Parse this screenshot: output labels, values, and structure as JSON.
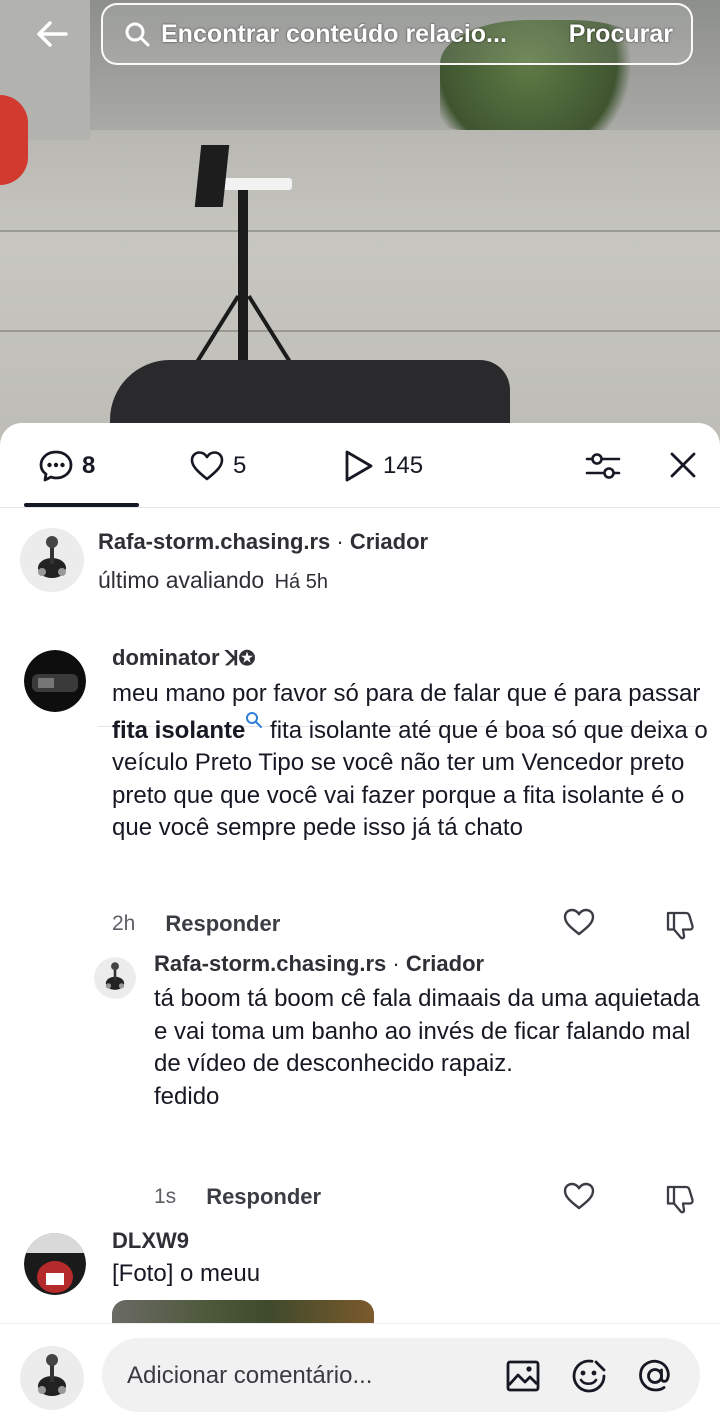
{
  "search": {
    "query": "Encontrar conteúdo relacio...",
    "button_label": "Procurar"
  },
  "stats": {
    "comments": "8",
    "likes": "5",
    "plays": "145"
  },
  "pinned": {
    "author": "Rafa-storm.chasing.rs",
    "separator": " · ",
    "badge": "Criador",
    "note": "último avaliando",
    "time": "Há 5h"
  },
  "comments": [
    {
      "author": "dominator",
      "author_suffix": "ꓘ✪",
      "text_before": "meu mano por favor só para de falar que é para passar ",
      "keyword": "fita isolante",
      "text_after": " fita isolante até que é boa só que deixa o veículo Preto Tipo se você não ter um Vencedor preto preto que que você vai fazer porque a fita isolante é o que você sempre pede isso já tá chato",
      "time": "2h",
      "reply_label": "Responder"
    },
    {
      "author": "Rafa-storm.chasing.rs",
      "separator": " · ",
      "badge": "Criador",
      "text": "tá boom tá boom cê fala dimaais da uma aquietada e vai toma um banho ao invés de ficar falando mal de vídeo de desconhecido rapaiz.",
      "text_line2": "fedido",
      "time": "1s",
      "reply_label": "Responder"
    },
    {
      "author": "DLXW9",
      "text": "[Foto] o meuu"
    }
  ],
  "input": {
    "placeholder": "Adicionar comentário..."
  },
  "colors": {
    "text": "#161823",
    "secondary": "#5d5f66",
    "divider": "#e5e5e7",
    "input_bg": "#f1f1f2",
    "search_keyword_icon": "#2f7fd8"
  },
  "icons": [
    "back-arrow-icon",
    "search-icon",
    "comment-icon",
    "heart-icon",
    "play-icon",
    "filter-icon",
    "close-icon",
    "like-icon",
    "dislike-icon",
    "image-icon",
    "emoji-icon",
    "mention-icon"
  ]
}
